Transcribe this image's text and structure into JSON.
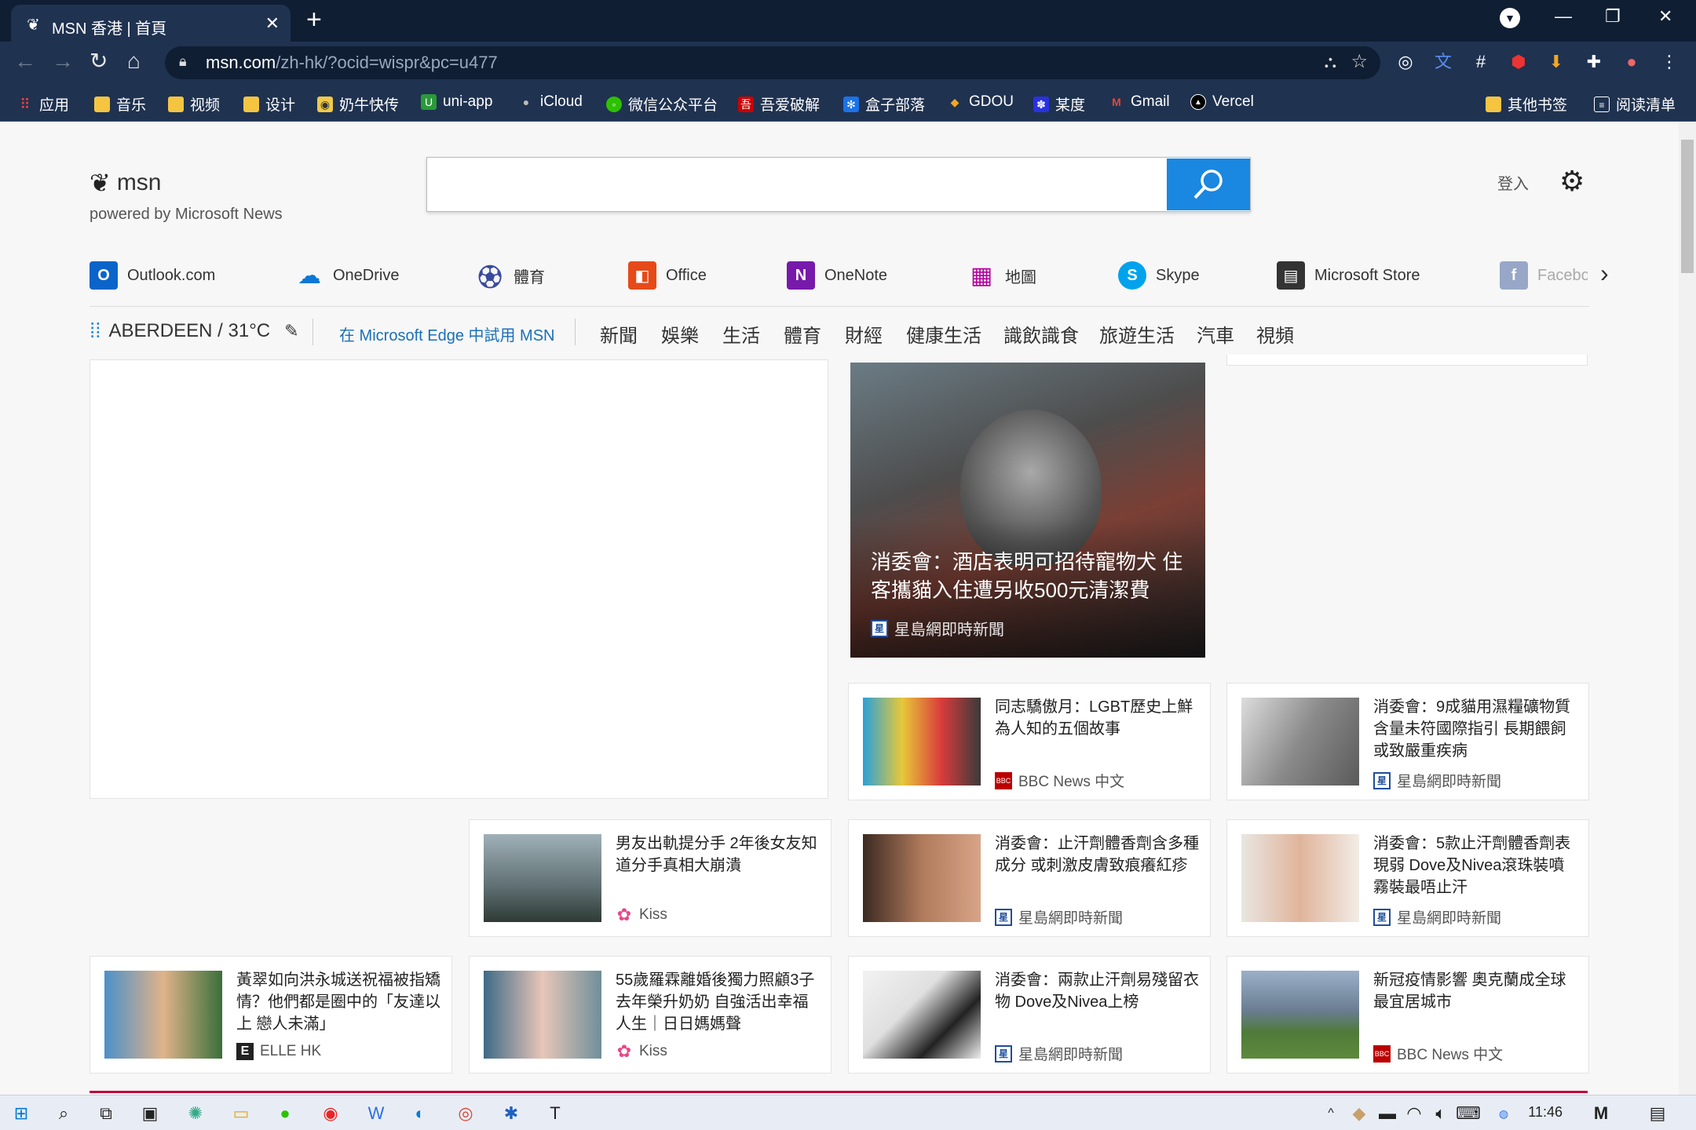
{
  "browser": {
    "tab_title": "MSN 香港 | 首頁",
    "url_host": "msn.com",
    "url_path": "/zh-hk/?ocid=wispr&pc=u477",
    "bookmarks": [
      "应用",
      "音乐",
      "视频",
      "设计",
      "奶牛快传",
      "uni-app",
      "iCloud",
      "微信公众平台",
      "吾爱破解",
      "盒子部落",
      "GDOU",
      "某度",
      "Gmail",
      "Vercel"
    ],
    "bookmarks_right": [
      "其他书签",
      "阅读清单"
    ]
  },
  "msn": {
    "logo_text": "msn",
    "powered_by": "powered by Microsoft News",
    "sign_in": "登入",
    "quick_links": [
      "Outlook.com",
      "OneDrive",
      "體育",
      "Office",
      "OneNote",
      "地圖",
      "Skype",
      "Microsoft Store",
      "Facebo"
    ],
    "weather": "ABERDEEN / 31°C",
    "edge_try": "在 Microsoft Edge 中試用 MSN",
    "nav": [
      "新聞",
      "娛樂",
      "生活",
      "體育",
      "財經",
      "健康生活",
      "識飲識食",
      "旅遊生活",
      "汽車",
      "視頻"
    ]
  },
  "hero": {
    "headline": "消委會：酒店表明可招待寵物犬 住客攜貓入住遭另收500元清潔費",
    "source": "星島網即時新聞"
  },
  "cards": [
    {
      "title": "同志驕傲月：LGBT歷史上鮮為人知的五個故事",
      "source": "BBC News 中文",
      "src_type": "bbc"
    },
    {
      "title": "消委會：9成貓用濕糧礦物質含量未符國際指引 長期餵飼或致嚴重疾病",
      "source": "星島網即時新聞",
      "src_type": "singtao"
    },
    {
      "title": "男友出軌提分手 2年後女友知道分手真相大崩潰",
      "source": "Kiss",
      "src_type": "kiss"
    },
    {
      "title": "消委會：止汗劑體香劑含多種成分 或刺激皮膚致痕癢紅疹",
      "source": "星島網即時新聞",
      "src_type": "singtao"
    },
    {
      "title": "消委會：5款止汗劑體香劑表現弱 Dove及Nivea滾珠裝噴霧裝最唔止汗",
      "source": "星島網即時新聞",
      "src_type": "singtao"
    },
    {
      "title": "黃翠如向洪永城送祝福被指矯情？他們都是圈中的「友達以上 戀人未滿」",
      "source": "ELLE HK",
      "src_type": "elle"
    },
    {
      "title": "55歲羅霖離婚後獨力照顧3子 去年榮升奶奶 自強活出幸福人生｜日日媽媽聲",
      "source": "Kiss",
      "src_type": "kiss"
    },
    {
      "title": "消委會：兩款止汗劑易殘留衣物 Dove及Nivea上榜",
      "source": "星島網即時新聞",
      "src_type": "singtao"
    },
    {
      "title": "新冠疫情影響 奧克蘭成全球最宜居城市",
      "source": "BBC News 中文",
      "src_type": "bbc"
    }
  ],
  "taskbar": {
    "time": "11:46"
  }
}
